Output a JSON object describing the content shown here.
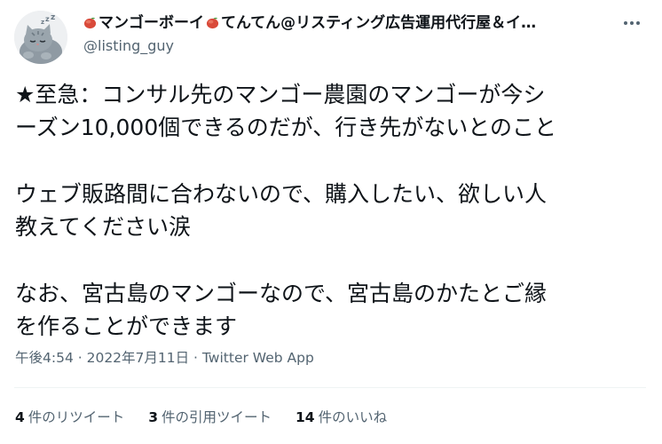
{
  "author": {
    "display_name": "マンゴーボーイ",
    "display_name_suffix": "てんてん@リスティング広告運用代行屋＆イ…",
    "handle": "@listing_guy",
    "avatar_icon": "sleeping-cat-avatar",
    "emoji_icon": "mango-icon"
  },
  "more_menu_icon": "more-options-icon",
  "tweet": {
    "lines": [
      "★至急：コンサル先のマンゴー農園のマンゴーが今シ",
      "ーズン10,000個できるのだが、行き先がないとのこと",
      "ウェブ販路間に合わないので、購入したい、欲しい人",
      "教えてください涙",
      "なお、宮古島のマンゴーなので、宮古島のかたとご縁",
      "を作ることができます"
    ]
  },
  "meta": {
    "time": "午後4:54",
    "separator": " · ",
    "date": "2022年7月11日",
    "source": "Twitter Web App"
  },
  "stats": {
    "retweets_count": "4",
    "retweets_label": "件のリツイート",
    "quotes_count": "3",
    "quotes_label": "件の引用ツイート",
    "likes_count": "14",
    "likes_label": "件のいいね"
  },
  "colors": {
    "text_primary": "#0f1419",
    "text_secondary": "#536471",
    "divider": "#eff3f4",
    "mango": "#d94a3a"
  }
}
